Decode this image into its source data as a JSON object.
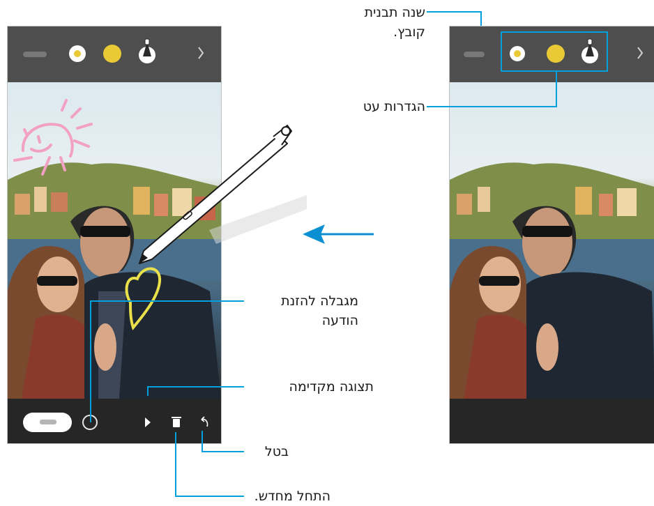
{
  "annotations": {
    "change_template": [
      "שנה תבנית",
      "קובץ."
    ],
    "pen_settings": "הגדרות עט",
    "message_limit": [
      "מגבלה להזנת",
      "הודעה"
    ],
    "preview": "תצוגה מקדימה",
    "undo": "בטל",
    "restart": "התחל מחדש."
  },
  "colors": {
    "accent_line": "#00a0dc",
    "arrow": "#0a8fd0",
    "pen_yellow": "#e9c935",
    "doodle_pink": "#f2a0c4",
    "doodle_yellow": "#e9e04a",
    "toolbar_bg": "#4e4e4e",
    "bottombar_bg": "#262626"
  },
  "icons": [
    "color-dot-icon",
    "yellow-dot-icon",
    "pen-icon",
    "chevron-right-icon",
    "timer-ring-icon",
    "play-icon",
    "trash-icon",
    "undo-icon",
    "s-pen-stylus",
    "arrow-left-icon"
  ]
}
